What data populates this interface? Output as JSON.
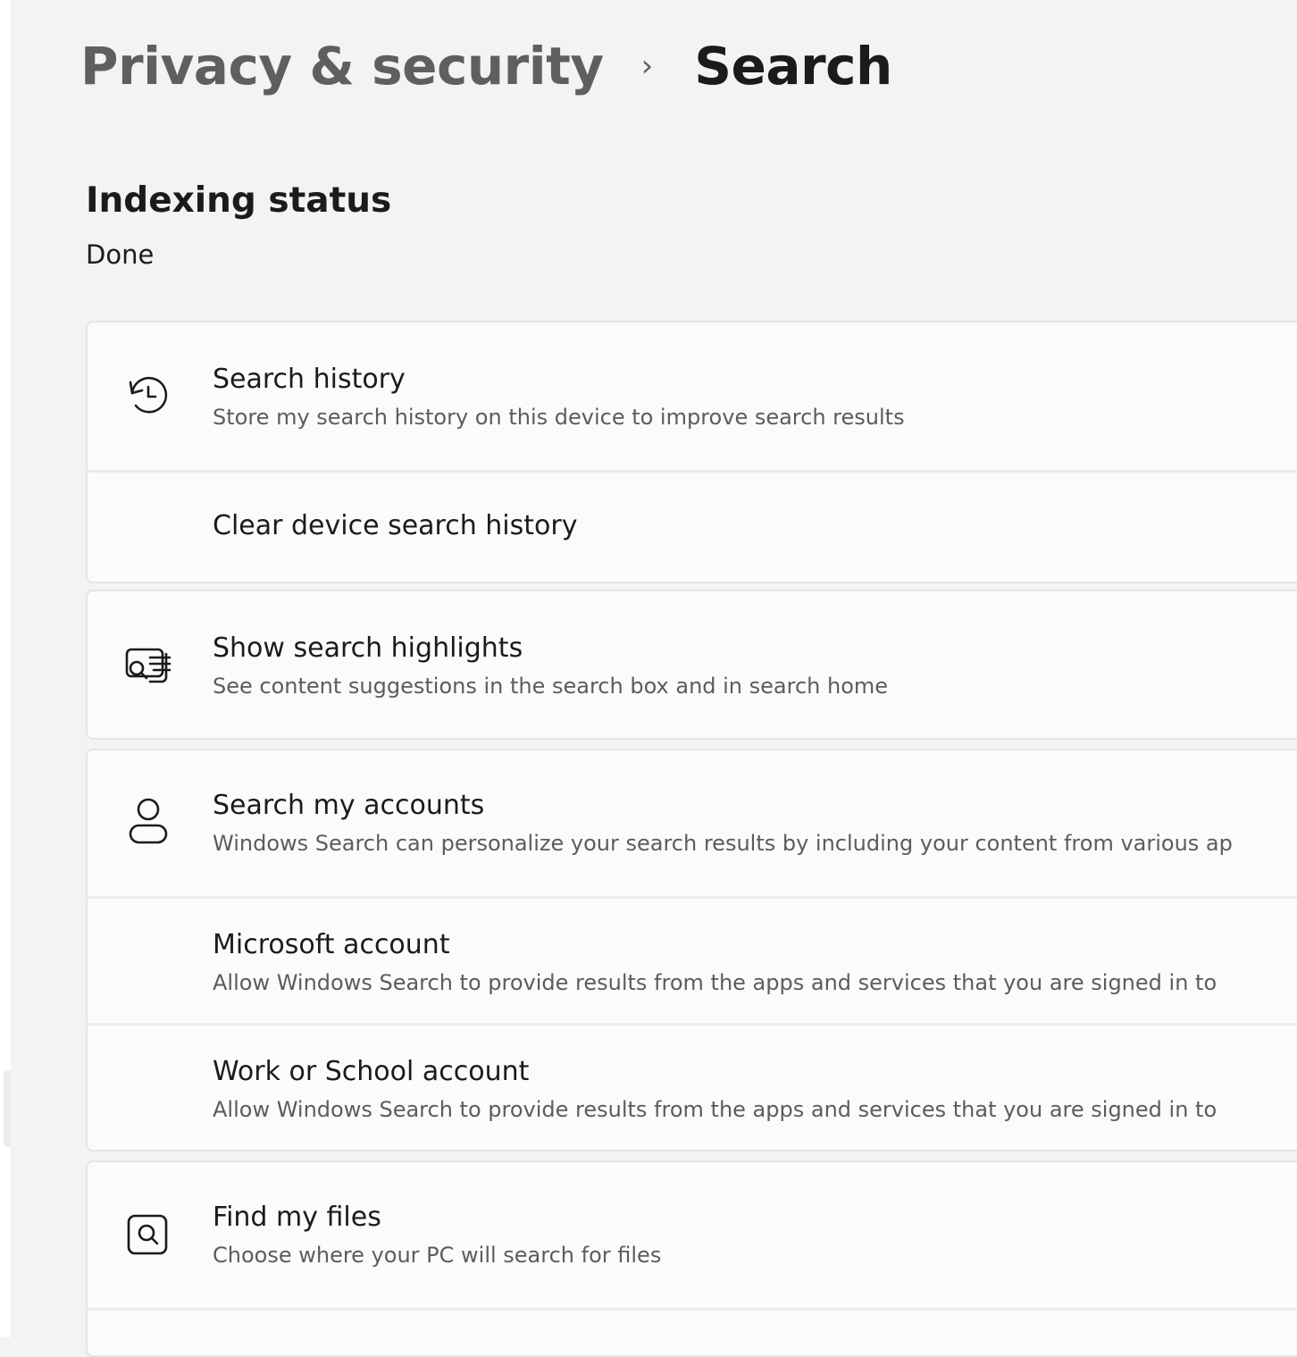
{
  "breadcrumb": {
    "parent": "Privacy & security",
    "separator": "›",
    "current": "Search"
  },
  "indexing": {
    "title": "Indexing status",
    "status": "Done"
  },
  "search_history": {
    "icon": "history-icon",
    "title": "Search history",
    "description": "Store my search history on this device to improve search results",
    "clear_label": "Clear device search history"
  },
  "search_highlights": {
    "icon": "search-highlights-icon",
    "title": "Show search highlights",
    "description": "See content suggestions in the search box and in search home"
  },
  "search_accounts": {
    "icon": "person-icon",
    "title": "Search my accounts",
    "description": "Windows Search can personalize your search results by including your content from various ap",
    "microsoft_title": "Microsoft account",
    "microsoft_description": "Allow Windows Search to provide results from the apps and services that you are signed in to",
    "work_title": "Work or School account",
    "work_description": "Allow Windows Search to provide results from the apps and services that you are signed in to"
  },
  "find_files": {
    "icon": "find-files-icon",
    "title": "Find my files",
    "description": "Choose where your PC will search for files"
  }
}
